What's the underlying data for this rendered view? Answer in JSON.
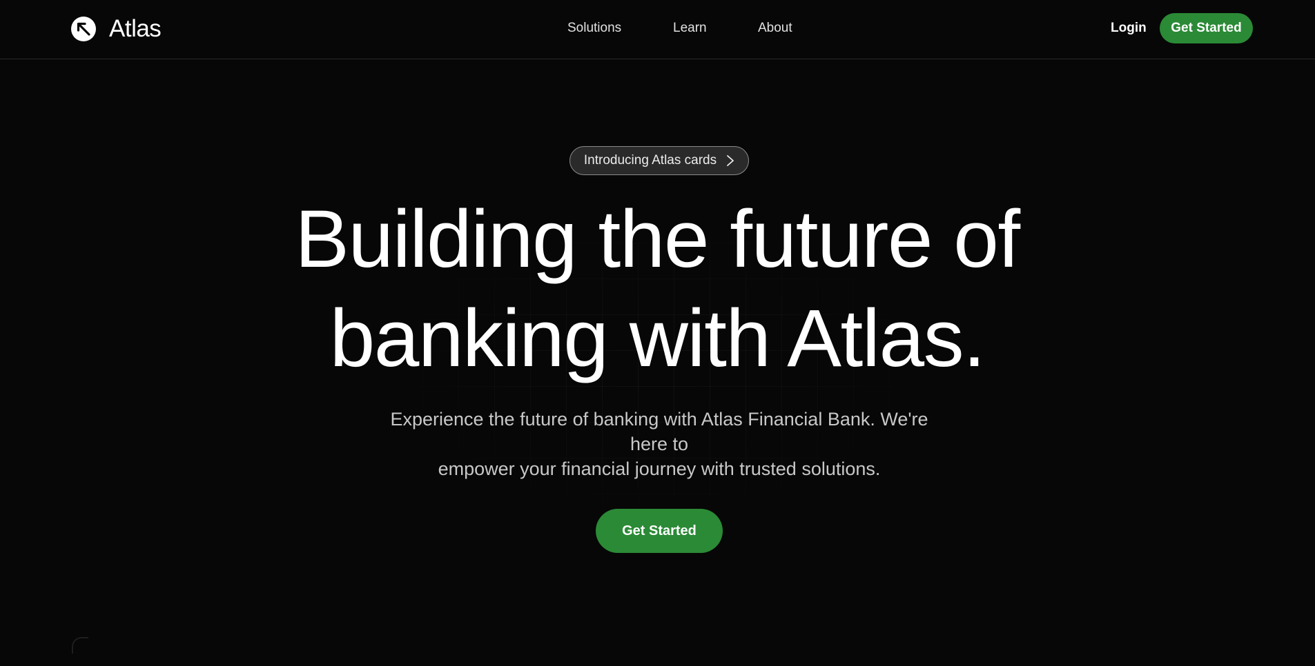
{
  "brand": {
    "name": "Atlas",
    "logo_icon": "arrow-up-left-circle-icon"
  },
  "nav": {
    "items": [
      {
        "label": "Solutions"
      },
      {
        "label": "Learn"
      },
      {
        "label": "About"
      }
    ]
  },
  "header_actions": {
    "login_label": "Login",
    "get_started_label": "Get Started"
  },
  "hero": {
    "announcement": {
      "label": "Introducing Atlas cards",
      "icon": "chevron-right-icon"
    },
    "title_line1": "Building the future of",
    "title_line2": "banking with Atlas.",
    "subtitle_line1": "Experience the future of banking with Atlas Financial Bank. We're here to",
    "subtitle_line2": "empower your financial journey with trusted solutions.",
    "cta_label": "Get Started"
  },
  "colors": {
    "background": "#070707",
    "accent_green": "#2b8a36",
    "text_primary": "#ffffff",
    "text_secondary": "#c8c8c8",
    "divider": "#2a2a2a"
  }
}
